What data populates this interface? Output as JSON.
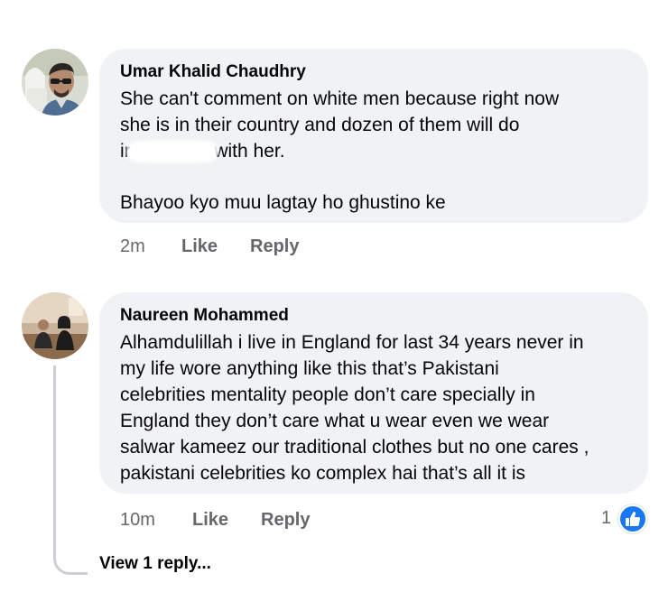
{
  "comments": [
    {
      "author": "Umar Khalid Chaudhry",
      "lines": [
        "She can't comment on white men because right now",
        "she is in their country and dozen of them will do",
        "ir '-re-u---e with her.",
        "",
        "Bhayoo kyo muu lagtay ho ghustino ke"
      ],
      "time": "2m",
      "like_label": "Like",
      "reply_label": "Reply"
    },
    {
      "author": "Naureen Mohammed",
      "lines": [
        "Alhamdulillah i live in England for last 34 years never in",
        "my life wore anything like this that’s Pakistani",
        "celebrities mentality people don’t care specially in",
        "England they don’t care what u wear even we wear",
        "salwar kameez our traditional clothes but no one cares ,",
        "pakistani celebrities ko complex hai that’s all it is"
      ],
      "time": "10m",
      "like_label": "Like",
      "reply_label": "Reply",
      "reaction_count": "1",
      "reaction_icon": "thumbs-up-icon",
      "view_replies_label": "View 1 reply..."
    }
  ],
  "colors": {
    "bubble": "#f0f2f5",
    "text": "#050505",
    "secondary_text": "#65676b",
    "like_blue": "#1877f2",
    "thread_line": "#ccd0d5"
  }
}
